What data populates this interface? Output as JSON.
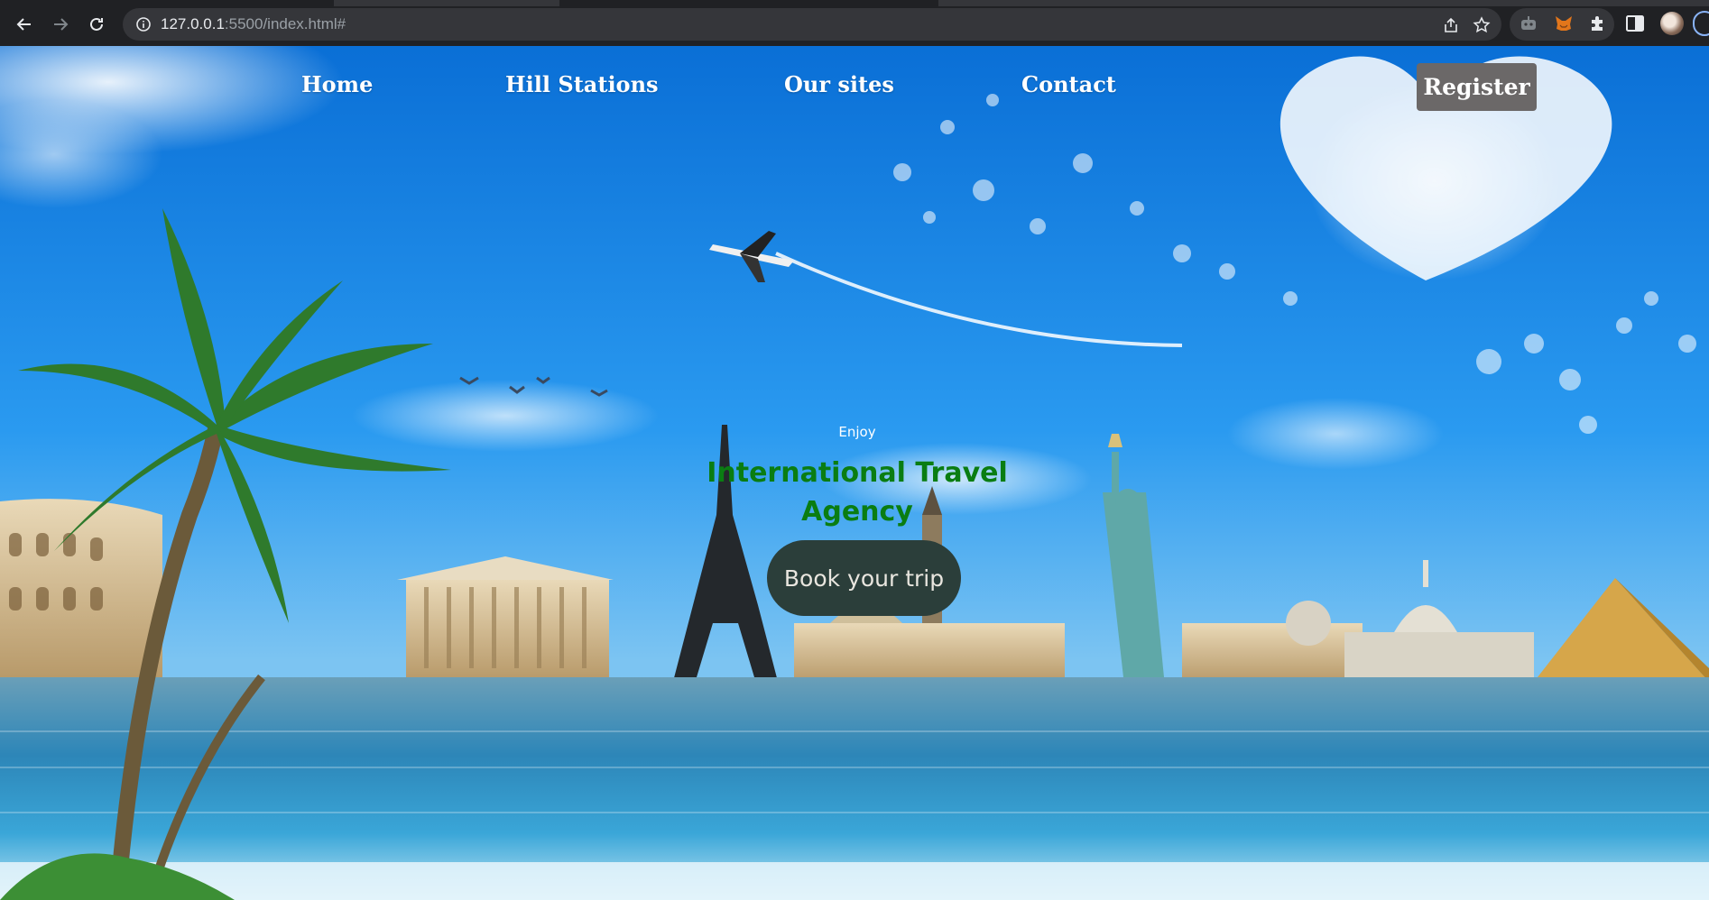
{
  "browser": {
    "url_host": "127.0.0.1",
    "url_rest": ":5500/index.html#",
    "icons": [
      "back-arrow-icon",
      "forward-arrow-icon",
      "reload-icon",
      "site-info-icon",
      "share-icon",
      "bookmark-star-icon",
      "extension-icon",
      "metamask-fox-icon",
      "puzzle-icon",
      "side-panel-icon",
      "profile-avatar",
      "menu-icon"
    ]
  },
  "nav": {
    "home": "Home",
    "hill_stations": "Hill Stations",
    "our_sites": "Our sites",
    "contact": "Contact",
    "register": "Register"
  },
  "hero": {
    "eyebrow": "Enjoy",
    "title_line1": "International Travel",
    "title_line2": "Agency",
    "cta": "Book your trip"
  },
  "colors": {
    "sky": "#1d8fe6",
    "title_green": "#0a7d12",
    "cta_bg": "#2b3e3a",
    "register_bg": "#6b6868",
    "chrome_bg": "#202124"
  }
}
